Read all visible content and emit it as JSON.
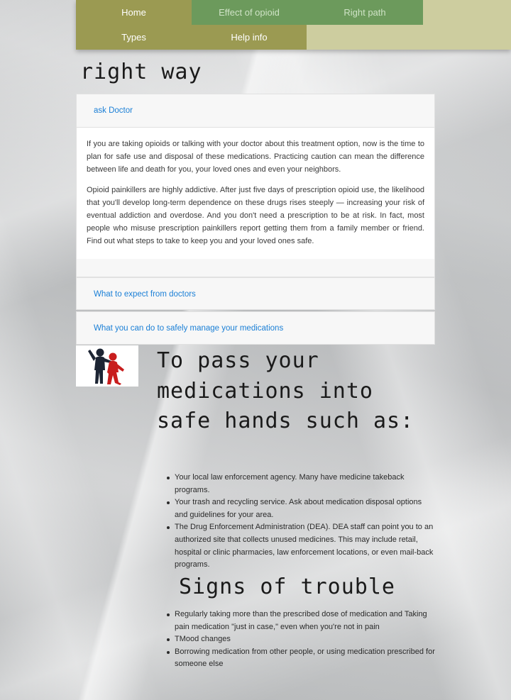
{
  "nav": {
    "home": "Home",
    "effect": "Effect of opioid",
    "right_path": "Right path",
    "types": "Types",
    "help": "Help info"
  },
  "heading_partial": "right way",
  "accordion": {
    "ask_doctor": {
      "title": "ask Doctor",
      "paragraphs": [
        "If you are taking opioids or talking with your doctor about this treatment option, now is the time to plan for safe use and disposal of these medications. Practicing caution can mean the difference between life and death for you, your loved ones and even your neighbors.",
        "Opioid painkillers are highly addictive. After just five days of prescription opioid use, the likelihood that you'll develop long-term dependence on these drugs rises steeply — increasing your risk of eventual addiction and overdose. And you don't need a prescription to be at risk. In fact, most people who misuse prescription painkillers report getting them from a family member or friend. Find out what steps to take to keep you and your loved ones safe."
      ]
    },
    "expect": {
      "title": "What to expect from doctors"
    },
    "manage": {
      "title": "What you can do to safely manage your medications"
    }
  },
  "pass_heading": "To pass your medications into safe hands such as:",
  "pass_list": [
    "Your local law enforcement agency. Many have medicine takeback programs.",
    "Your trash and recycling service. Ask about medication disposal options and guidelines for your area.",
    "The Drug Enforcement Administration (DEA). DEA staff can point you to an authorized site that collects unused medicines. This may include retail, hospital or clinic pharmacies, law enforcement locations, or even mail-back programs."
  ],
  "signs_heading": "Signs of trouble",
  "signs_list": [
    "Regularly taking more than the prescribed dose of medication and Taking pain medication \"just in case,\" even when you're not in pain",
    "TMood changes",
    "Borrowing medication from other people, or using medication prescribed for someone else"
  ],
  "colors": {
    "nav_bar": "#cdcd9f",
    "nav_olive": "#9b9a52",
    "nav_green": "#6c9a5c",
    "link_blue": "#1a7fd6"
  }
}
